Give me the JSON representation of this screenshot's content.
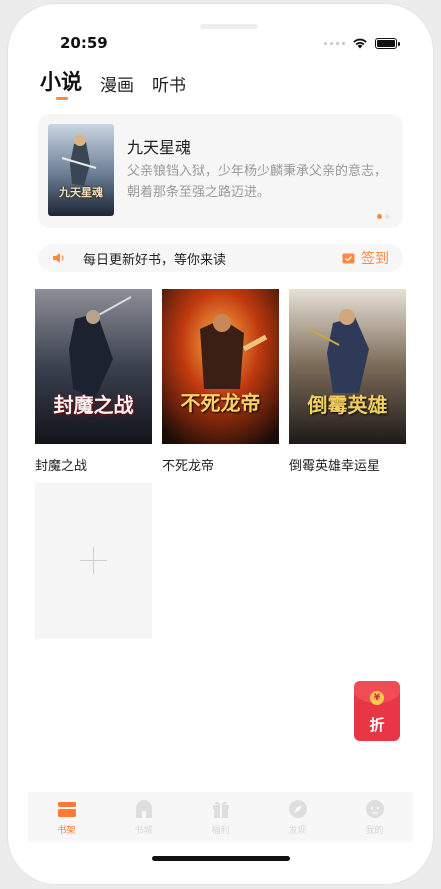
{
  "status_bar": {
    "time": "20:59"
  },
  "top_tabs": [
    {
      "label": "小说",
      "active": true
    },
    {
      "label": "漫画",
      "active": false
    },
    {
      "label": "听书",
      "active": false
    }
  ],
  "featured": {
    "title": "九天星魂",
    "description": "父亲锒铛入狱，少年杨少麟秉承父亲的意志，朝着那条至强之路迈进。",
    "cover_text": "九天星魂"
  },
  "notice": {
    "text": "每日更新好书，等你来读",
    "signin_label": "签到"
  },
  "books": [
    {
      "title": "封魔之战",
      "cover_text": "封魔之战"
    },
    {
      "title": "不死龙帝",
      "cover_text": "不死龙帝"
    },
    {
      "title": "倒霉英雄幸运星",
      "cover_text": "倒霉英雄"
    }
  ],
  "redpack": {
    "label": "折",
    "coin": "¥"
  },
  "bottom_tabs": [
    {
      "label": "书架",
      "icon": "bookshelf-icon",
      "active": true
    },
    {
      "label": "书城",
      "icon": "bookstore-icon",
      "active": false
    },
    {
      "label": "福利",
      "icon": "gift-icon",
      "active": false
    },
    {
      "label": "发现",
      "icon": "discover-icon",
      "active": false
    },
    {
      "label": "我的",
      "icon": "profile-icon",
      "active": false
    }
  ],
  "colors": {
    "accent": "#ff8a3d",
    "redpack": "#e93645"
  }
}
